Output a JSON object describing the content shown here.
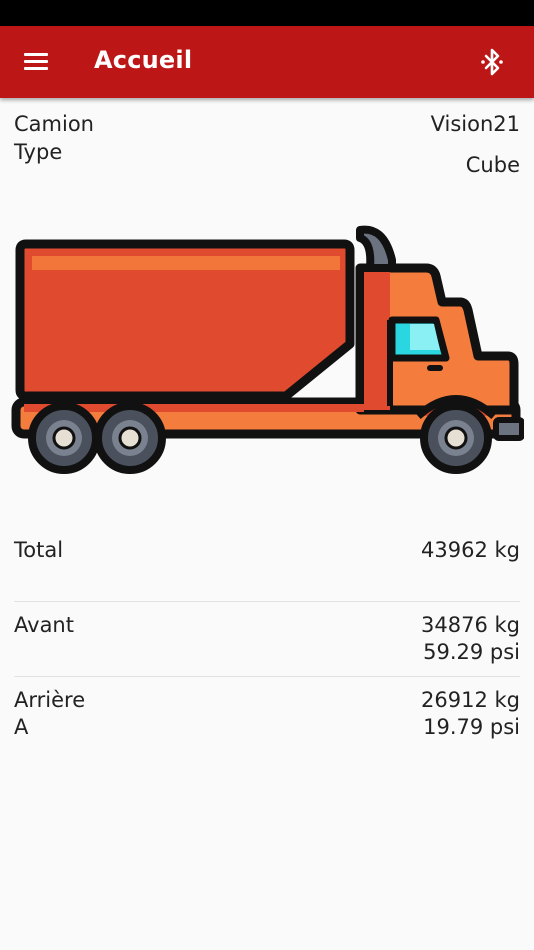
{
  "app_bar": {
    "title": "Accueil",
    "menu_icon": "menu-icon",
    "bluetooth_icon": "bluetooth-icon",
    "color": "#bd1616"
  },
  "info": {
    "camion_label": "Camion",
    "camion_value": "Vision21",
    "type_label": "Type",
    "type_value": "Cube"
  },
  "truck_image": "truck-illustration",
  "weights": {
    "total": {
      "label": "Total",
      "kg": "43962 kg"
    },
    "avant": {
      "label": "Avant",
      "kg": "34876 kg",
      "psi": "59.29 psi"
    },
    "arriere": {
      "label": "Arrière",
      "sublabel": "A",
      "kg": "26912 kg",
      "psi": "19.79 psi"
    }
  }
}
